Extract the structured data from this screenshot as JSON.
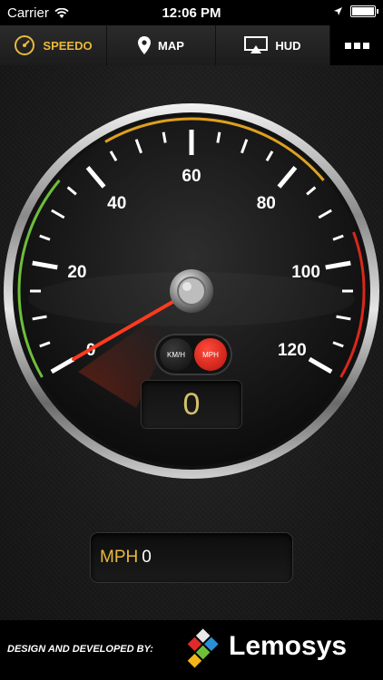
{
  "status_bar": {
    "carrier": "Carrier",
    "time": "12:06 PM"
  },
  "tabs": [
    {
      "label": "SPEEDO",
      "active": true
    },
    {
      "label": "MAP",
      "active": false
    },
    {
      "label": "HUD",
      "active": false
    }
  ],
  "gauge": {
    "labels": [
      "0",
      "20",
      "40",
      "60",
      "80",
      "100",
      "120"
    ],
    "min": 0,
    "max": 120,
    "current_speed": 0
  },
  "unit_toggle": {
    "kmh_label": "KM/H",
    "mph_label": "MPH",
    "selected": "MPH"
  },
  "speed_display": "0",
  "readout": {
    "unit": "MPH",
    "value": "0"
  },
  "footer": {
    "credit": "DESIGN AND DEVELOPED BY:",
    "brand": "Lemosys"
  },
  "colors": {
    "accent": "#e9b93a",
    "needle": "#ff3b1f",
    "mph_button": "#e8261a"
  }
}
